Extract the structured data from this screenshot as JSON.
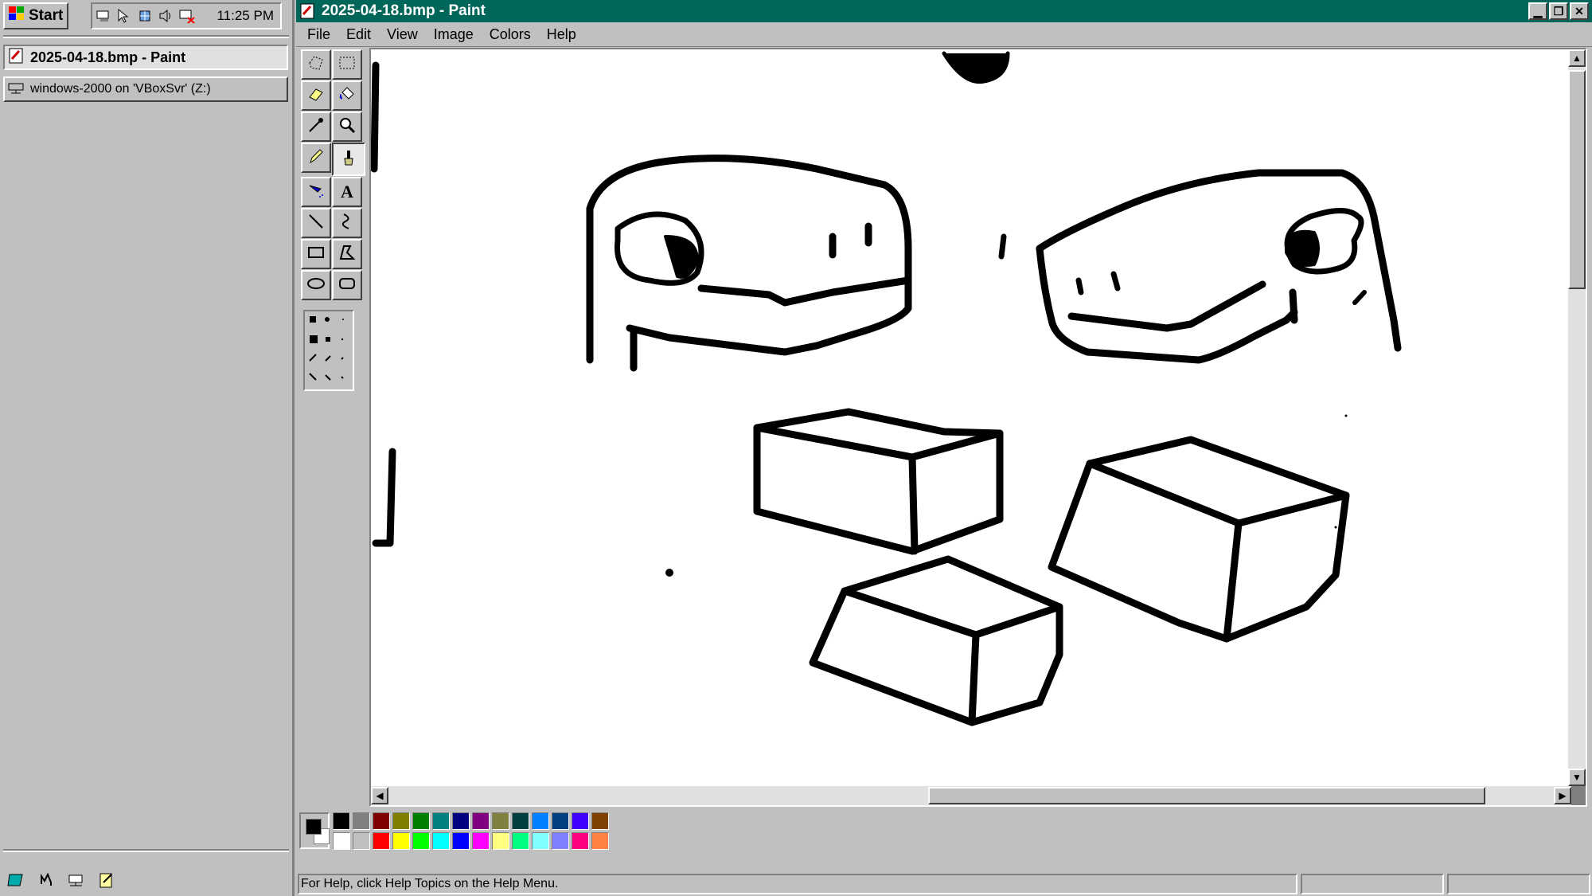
{
  "taskbar": {
    "start_label": "Start",
    "clock": "11:25 PM",
    "tasks": [
      {
        "label": "2025-04-18.bmp - Paint",
        "icon": "paint-icon"
      },
      {
        "label": "windows-2000 on 'VBoxSvr' (Z:)",
        "icon": "network-drive-icon"
      }
    ],
    "tray_icons": [
      "network-icon",
      "mouse-integration-icon",
      "shared-folders-icon",
      "volume-icon",
      "network-disconnected-icon"
    ],
    "quick_launch": [
      "show-desktop-icon",
      "internet-explorer-icon",
      "network-icon",
      "notepad-icon"
    ]
  },
  "window": {
    "title": "2025-04-18.bmp - Paint",
    "menu": [
      "File",
      "Edit",
      "View",
      "Image",
      "Colors",
      "Help"
    ],
    "tools": [
      "free-form-select-icon",
      "select-icon",
      "eraser-icon",
      "fill-icon",
      "pick-color-icon",
      "magnifier-icon",
      "pencil-icon",
      "brush-icon",
      "airbrush-icon",
      "text-icon",
      "line-icon",
      "curve-icon",
      "rectangle-icon",
      "polygon-icon",
      "ellipse-icon",
      "rounded-rectangle-icon"
    ],
    "active_tool": "brush-icon",
    "text_tool_glyph": "A",
    "foreground_color": "#000000",
    "background_color": "#ffffff",
    "palette_top": [
      "#000000",
      "#808080",
      "#800000",
      "#808000",
      "#008000",
      "#008080",
      "#000080",
      "#800080",
      "#808040",
      "#004040",
      "#0080ff",
      "#004080",
      "#4000ff",
      "#804000"
    ],
    "palette_bottom": [
      "#ffffff",
      "#c0c0c0",
      "#ff0000",
      "#ffff00",
      "#00ff00",
      "#00ffff",
      "#0000ff",
      "#ff00ff",
      "#ffff80",
      "#00ff80",
      "#80ffff",
      "#8080ff",
      "#ff0080",
      "#ff8040"
    ],
    "status": "For Help, click Help Topics on the Help Menu.",
    "accent_titlebar": "#00665a"
  }
}
